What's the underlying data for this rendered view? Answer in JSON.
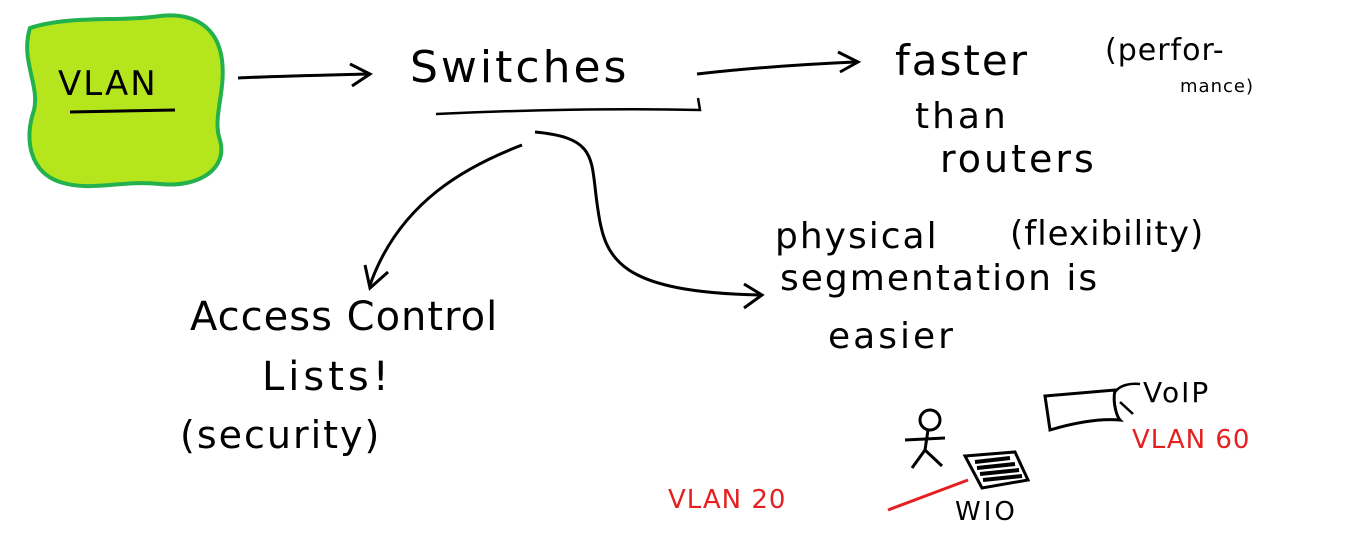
{
  "vlan_label": "VLAN",
  "switches_label": "Switches",
  "faster": {
    "line1": "faster",
    "perf_open": "(perfor-",
    "perf_close": "mance)",
    "line2": "than",
    "line3": "routers"
  },
  "physical": {
    "line1": "physical",
    "flex": "(flexibility)",
    "line2": "segmentation is",
    "line3": "easier"
  },
  "acl": {
    "line1": "Access Control",
    "line2": "Lists!",
    "line3": "(security)"
  },
  "devices": {
    "voip": "VoIP",
    "vlan60": "VLAN 60",
    "vlan20": "VLAN 20",
    "wio": "WIO"
  },
  "colors": {
    "vlan_fill": "#b5e61d",
    "vlan_edge": "#22b14c",
    "ink": "#000000",
    "accent_red": "#e52020"
  }
}
